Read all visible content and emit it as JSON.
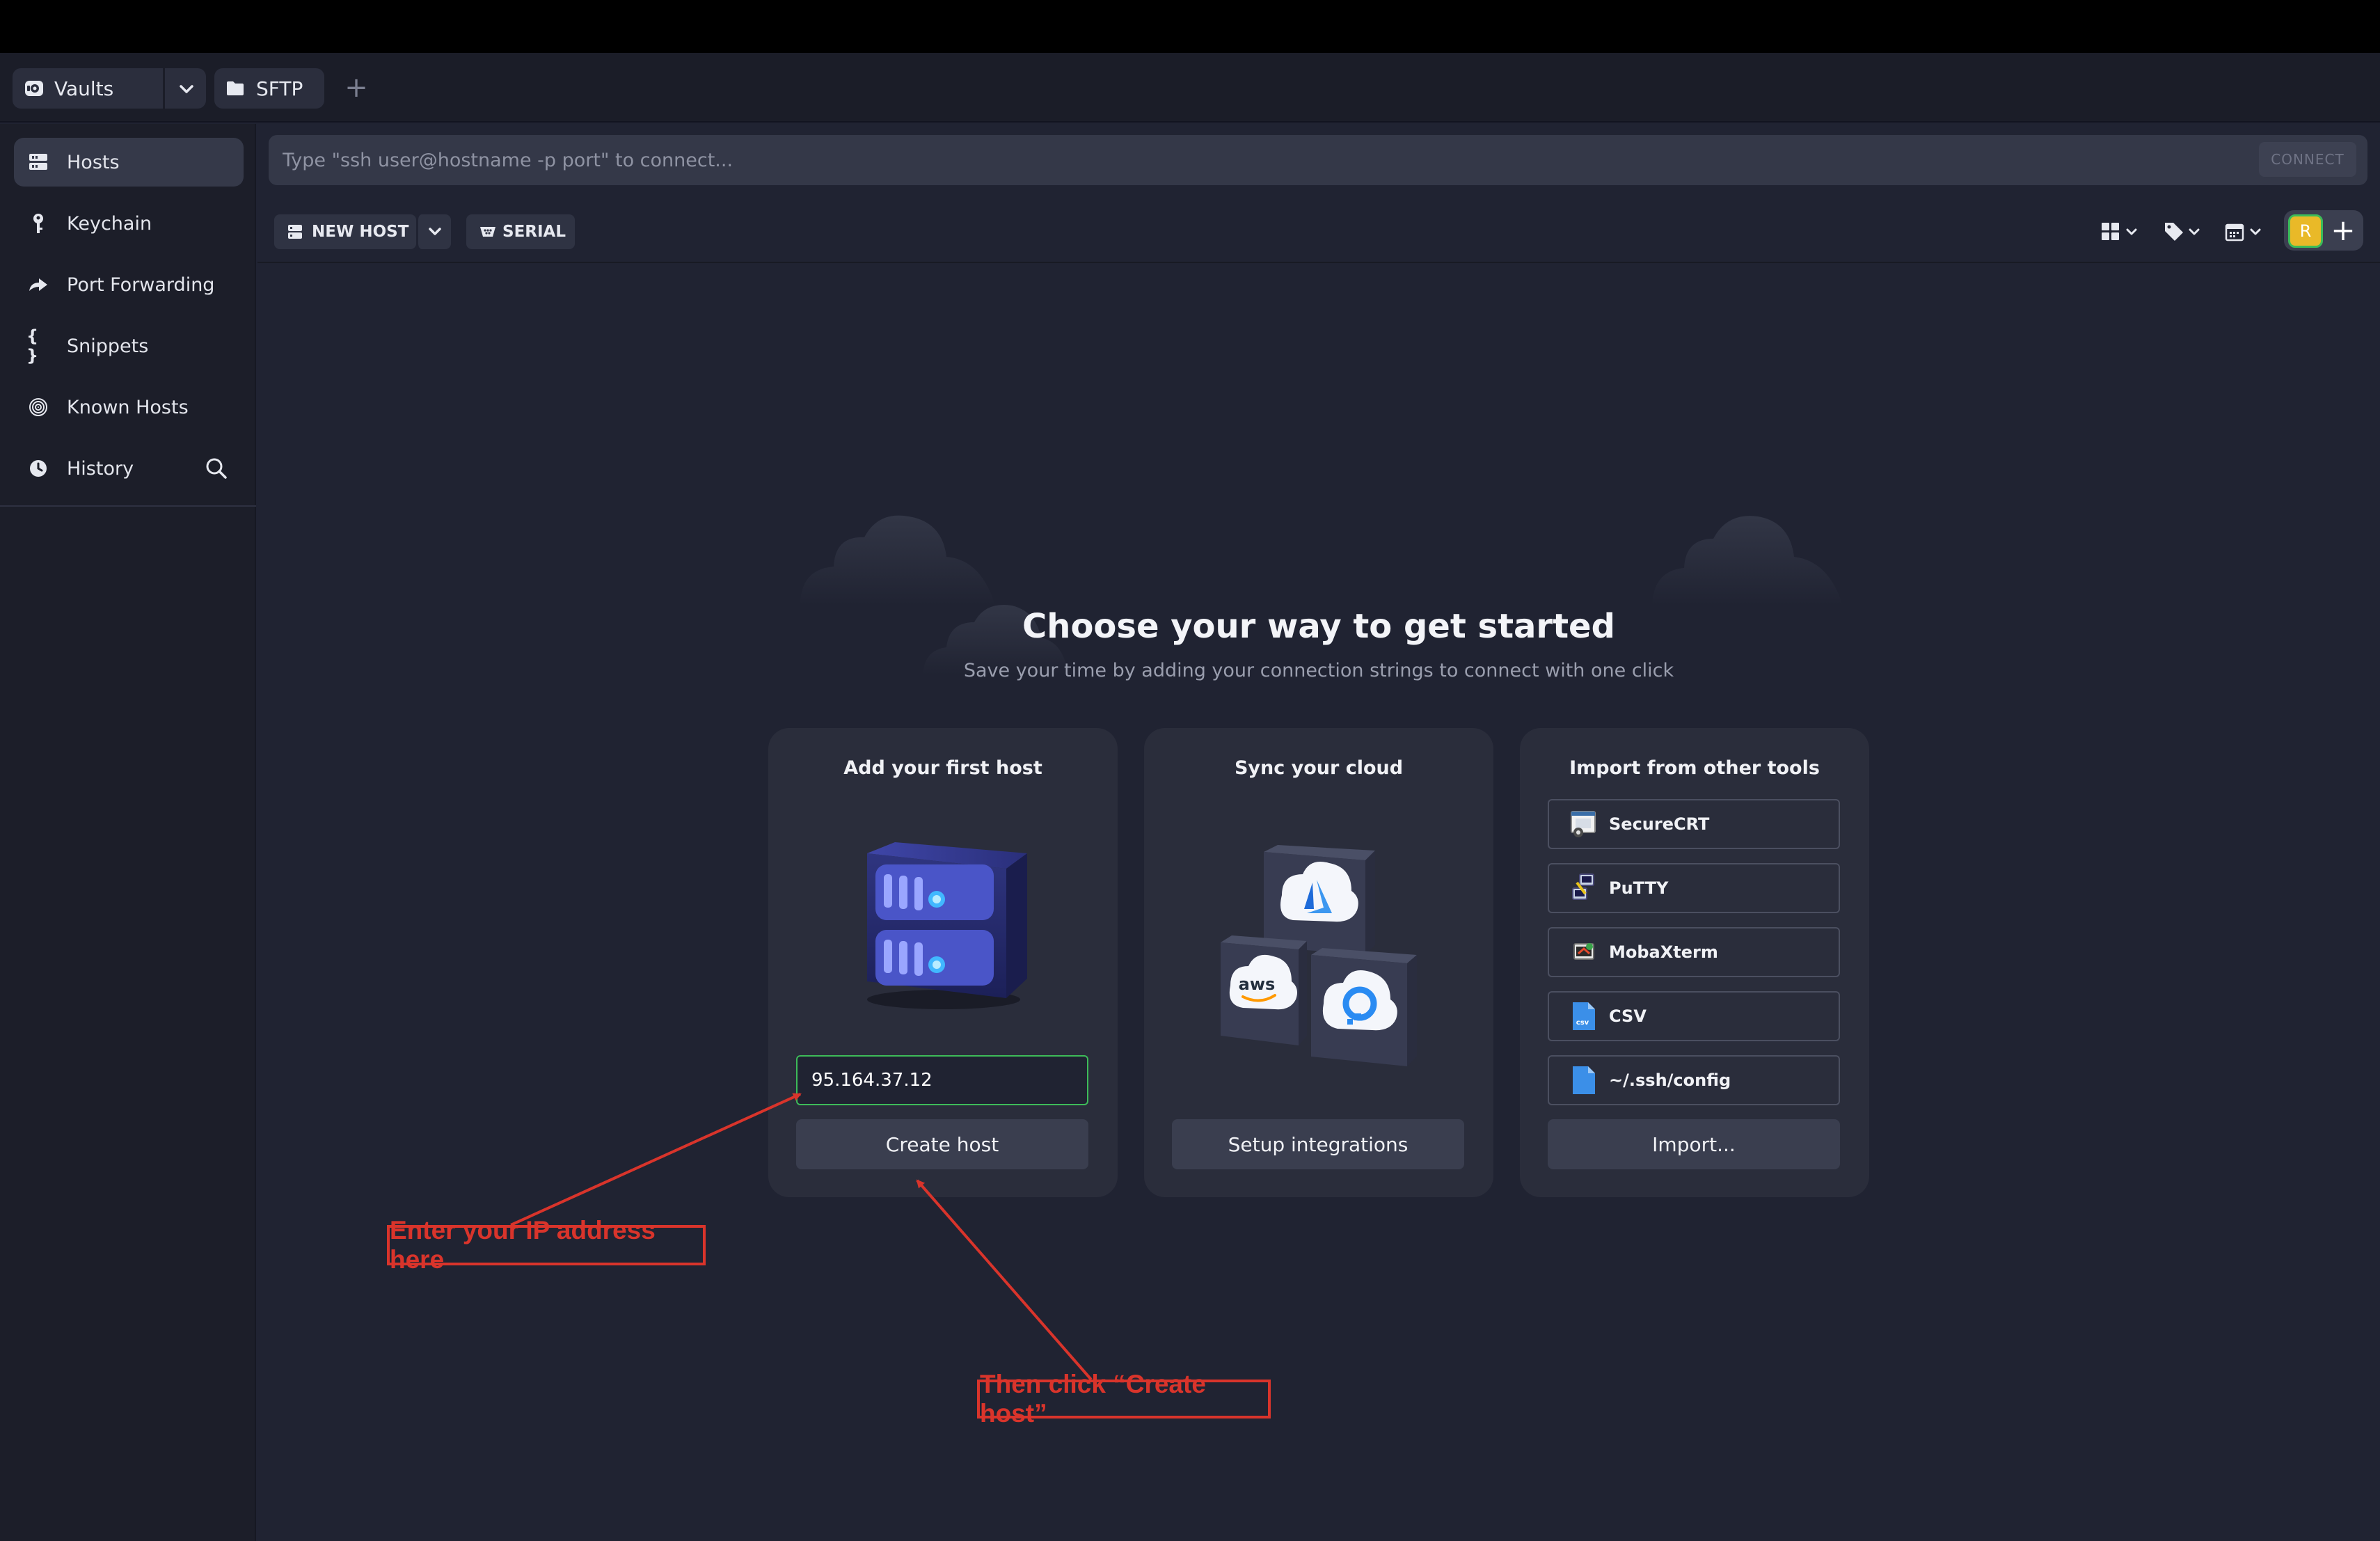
{
  "tabs": {
    "vaults_label": "Vaults",
    "sftp_label": "SFTP",
    "add_icon": "plus-icon"
  },
  "sidebar": {
    "items": [
      {
        "label": "Hosts",
        "icon": "hosts-icon",
        "active": true
      },
      {
        "label": "Keychain",
        "icon": "key-icon"
      },
      {
        "label": "Port Forwarding",
        "icon": "forward-icon"
      },
      {
        "label": "Snippets",
        "icon": "braces-icon"
      },
      {
        "label": "Known Hosts",
        "icon": "fingerprint-icon"
      },
      {
        "label": "History",
        "icon": "clock-icon"
      }
    ]
  },
  "connect_bar": {
    "placeholder": "Type \"ssh user@hostname -p port\" to connect...",
    "connect_label": "CONNECT"
  },
  "toolbar": {
    "new_host_label": "NEW HOST",
    "serial_label": "SERIAL",
    "avatar_initial": "R"
  },
  "hero": {
    "title": "Choose your way to get started",
    "subtitle": "Save your time by adding your connection strings to connect with one click"
  },
  "cards": {
    "host": {
      "title": "Add your first host",
      "input_value": "95.164.37.12",
      "button_label": "Create host"
    },
    "cloud": {
      "title": "Sync your cloud",
      "aws_text": "aws",
      "button_label": "Setup integrations"
    },
    "import": {
      "title": "Import from other tools",
      "tools": [
        "SecureCRT",
        "PuTTY",
        "MobaXterm",
        "CSV",
        "~/.ssh/config"
      ],
      "csv_icon_text": "csv",
      "button_label": "Import..."
    }
  },
  "annotations": {
    "ip_note": "Enter your IP address here",
    "create_note": "Then click “Create host”"
  },
  "colors": {
    "accent_green": "#3dbb59",
    "annotation_red": "#d9342b",
    "avatar_yellow": "#e9b928"
  }
}
